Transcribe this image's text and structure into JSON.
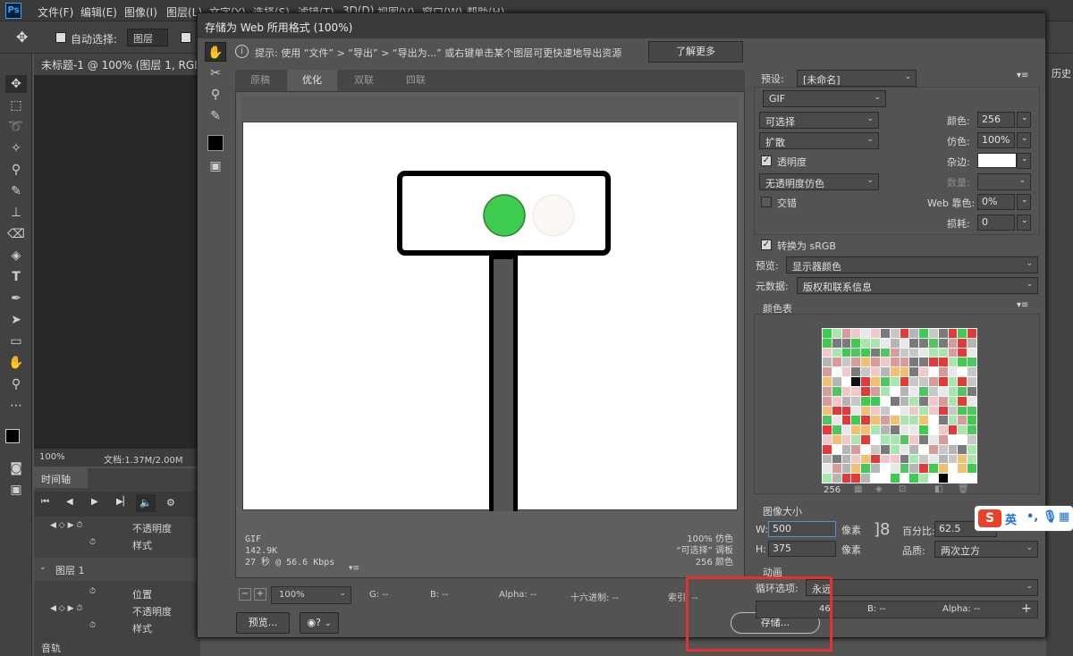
{
  "app": {
    "logo": "Ps",
    "menus": [
      "文件(F)",
      "编辑(E)",
      "图像(I)",
      "图层(L)",
      "文字(Y)",
      "选择(S)",
      "滤镜(T)",
      "3D(D)",
      "视图(V)",
      "窗口(W)",
      "帮助(H)"
    ],
    "options": {
      "auto_select_label": "自动选择:",
      "auto_select_value": "图层"
    },
    "doc_tab": "未标题-1 @ 100% (图层 1, RGB/8#)",
    "status": {
      "zoom": "100%",
      "doc": "文档:1.37M/2.00M"
    },
    "timeline": {
      "tab": "时间轴",
      "rows": [
        "不透明度",
        "样式"
      ],
      "layer": "图层 1",
      "layer_rows": [
        "位置",
        "不透明度",
        "样式"
      ],
      "audio": "音轨"
    },
    "history_tab": "历史"
  },
  "dialog": {
    "title": "存储为 Web 所用格式 (100%)",
    "hint": "提示: 使用 “文件” > “导出” > “导出为...” 或右键单击某个图层可更快速地导出资源",
    "learn_more": "了解更多",
    "view_tabs": [
      "原稿",
      "优化",
      "双联",
      "四联"
    ],
    "preview_info_left": [
      "GIF",
      "142.9K",
      "27 秒 @ 56.6 Kbps"
    ],
    "preview_info_right": [
      "100% 仿色",
      "“可选择” 调板",
      "256 颜色"
    ],
    "bottom": {
      "zoom": "100%",
      "r": "G: --",
      "b": "B: --",
      "alpha": "Alpha: --",
      "hex": "十六进制: --",
      "index": "索引: --"
    },
    "preview_button": "预览...",
    "save_button": "存储...",
    "settings": {
      "preset_label": "预设:",
      "preset_value": "[未命名]",
      "format": "GIF",
      "reduction": "可选择",
      "dither_algo": "扩散",
      "transparency_label": "透明度",
      "transparency_checked": true,
      "trans_dither": "无透明度仿色",
      "interlace_label": "交错",
      "interlace_checked": false,
      "colors_label": "颜色:",
      "colors_value": "256",
      "dither_label": "仿色:",
      "dither_value": "100%",
      "matte_label": "杂边:",
      "amount_label": "数量:",
      "web_snap_label": "Web 靠色:",
      "web_snap_value": "0%",
      "lossy_label": "损耗:",
      "lossy_value": "0",
      "convert_srgb_label": "转换为 sRGB",
      "convert_srgb_checked": true,
      "preview_label": "预览:",
      "preview_value": "显示器颜色",
      "metadata_label": "元数据:",
      "metadata_value": "版权和联系信息",
      "color_table_label": "颜色表",
      "color_count": "256",
      "image_size_label": "图像大小",
      "w_label": "W:",
      "w_value": "500",
      "h_label": "H:",
      "h_value": "375",
      "px": "像素",
      "percent_label": "百分比:",
      "percent_value": "62.5",
      "quality_label": "品质:",
      "quality_value": "两次立方",
      "animation_label": "动画",
      "loop_label": "循环选项:",
      "loop_value": "永远",
      "anim_frame": "46",
      "anim_b": "B: --",
      "anim_alpha": "Alpha: --"
    }
  },
  "ime": {
    "logo": "S",
    "lang": "英"
  },
  "colors": {
    "green_light": "#3dcc4e",
    "off_light": "#fbf7f2",
    "highlight": "#e53030",
    "swatches": [
      "#3dcc4e",
      "#a8e6b0",
      "#f2c7c7",
      "#e8e8e8",
      "#f3c070",
      "#c7c7c7",
      "#e53838",
      "#ffffff",
      "#7a7a7a",
      "#d99a9a",
      "#4fc660",
      "#b5b5b5"
    ]
  }
}
